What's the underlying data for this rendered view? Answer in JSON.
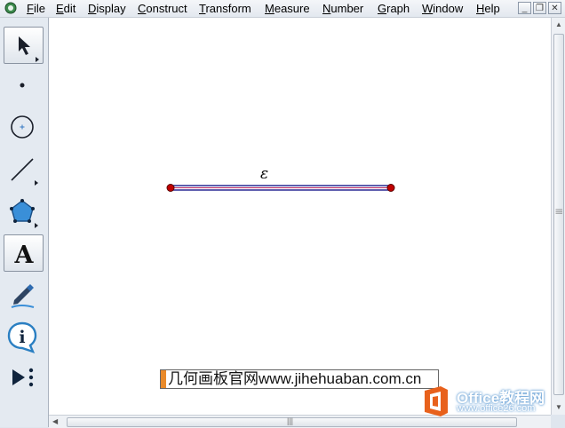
{
  "menu": {
    "items": [
      "File",
      "Edit",
      "Display",
      "Construct",
      "Transform",
      "Measure",
      "Number",
      "Graph",
      "Window",
      "Help"
    ]
  },
  "window_controls": {
    "minimize": "_",
    "restore": "❐",
    "close": "✕"
  },
  "tools": [
    {
      "name": "selection-arrow-tool",
      "icon": "arrow-icon"
    },
    {
      "name": "point-tool",
      "icon": "point-icon"
    },
    {
      "name": "compass-tool",
      "icon": "circle-icon"
    },
    {
      "name": "straightedge-tool",
      "icon": "line-icon"
    },
    {
      "name": "polygon-tool",
      "icon": "polygon-icon"
    },
    {
      "name": "text-tool",
      "icon": "text-A-icon",
      "label": "A",
      "active": true
    },
    {
      "name": "marker-tool",
      "icon": "marker-pen-icon"
    },
    {
      "name": "information-tool",
      "icon": "info-icon",
      "label": "i"
    },
    {
      "name": "custom-tool",
      "icon": "play-more-icon"
    }
  ],
  "canvas": {
    "segment_label": "ε",
    "segment_color": "#1a1a8c",
    "point_color": "#c00000"
  },
  "watermark": {
    "text": "几何画板官网www.jihehuaban.com.cn"
  },
  "office_logo": {
    "name": "Office教程网",
    "url": "www.office26.com",
    "color": "#e8611c"
  },
  "scrollbar": {
    "grip": "|||"
  }
}
